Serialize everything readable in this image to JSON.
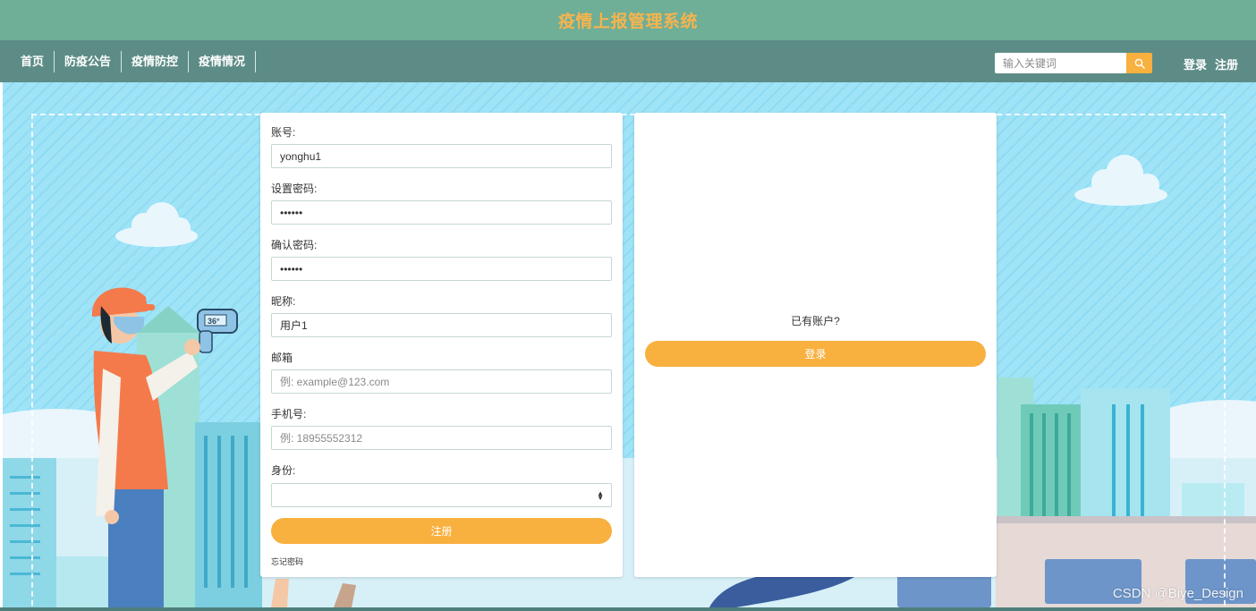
{
  "header": {
    "title": "疫情上报管理系统"
  },
  "nav": {
    "links": [
      "首页",
      "防疫公告",
      "疫情防控",
      "疫情情况"
    ],
    "search_placeholder": "输入关键词",
    "login_label": "登录",
    "register_label": "注册"
  },
  "form": {
    "account_label": "账号:",
    "account_value": "yonghu1",
    "password_label": "设置密码:",
    "password_value": "123456",
    "confirm_label": "确认密码:",
    "confirm_value": "123456",
    "nickname_label": "昵称:",
    "nickname_value": "用户1",
    "email_label": "邮箱",
    "email_placeholder": "例: example@123.com",
    "phone_label": "手机号:",
    "phone_placeholder": "例: 18955552312",
    "role_label": "身份:",
    "submit_label": "注册",
    "forgot_label": "忘记密码"
  },
  "side": {
    "prompt": "已有账户?",
    "login_button": "登录"
  },
  "watermark": "CSDN @Biye_Design",
  "colors": {
    "accent": "#f8b03f",
    "header_bg": "#6fae97",
    "nav_bg": "#5d8c86",
    "title": "#f6b44e"
  }
}
